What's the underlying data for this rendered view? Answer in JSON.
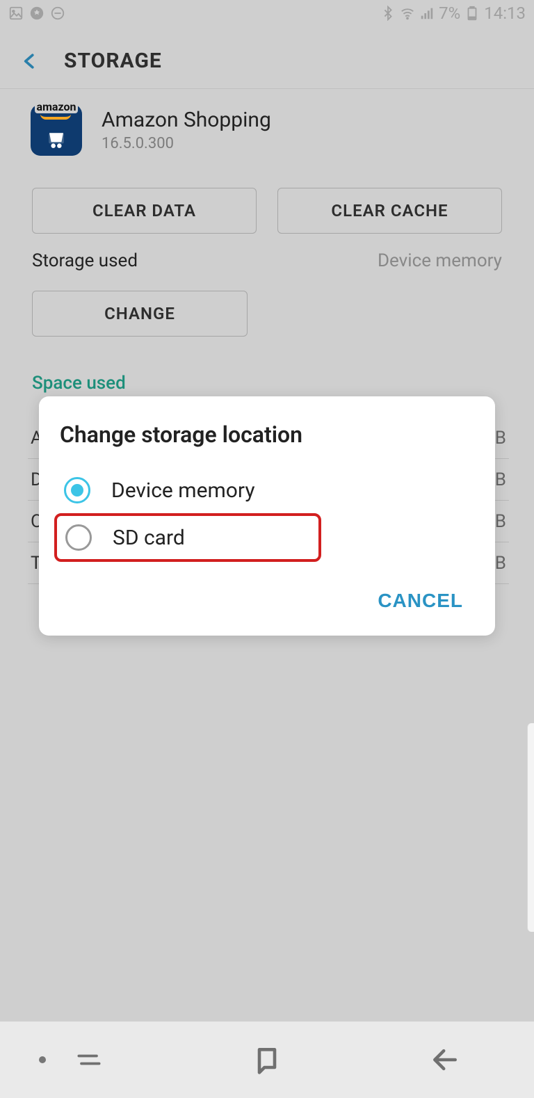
{
  "status": {
    "battery_pct": "7%",
    "time": "14:13"
  },
  "header": {
    "title": "STORAGE"
  },
  "app": {
    "name": "Amazon Shopping",
    "version": "16.5.0.300"
  },
  "buttons": {
    "clear_data": "CLEAR DATA",
    "clear_cache": "CLEAR CACHE",
    "change": "CHANGE"
  },
  "storage_used": {
    "label": "Storage used",
    "value": "Device memory"
  },
  "section": {
    "space_used": "Space used"
  },
  "bg_rows": [
    {
      "l": "A",
      "r": "B"
    },
    {
      "l": "D",
      "r": "B"
    },
    {
      "l": "C",
      "r": "B"
    },
    {
      "l": "T",
      "r": "B"
    }
  ],
  "dialog": {
    "title": "Change storage location",
    "options": [
      {
        "label": "Device memory",
        "checked": true
      },
      {
        "label": "SD card",
        "checked": false
      }
    ],
    "cancel": "CANCEL"
  }
}
